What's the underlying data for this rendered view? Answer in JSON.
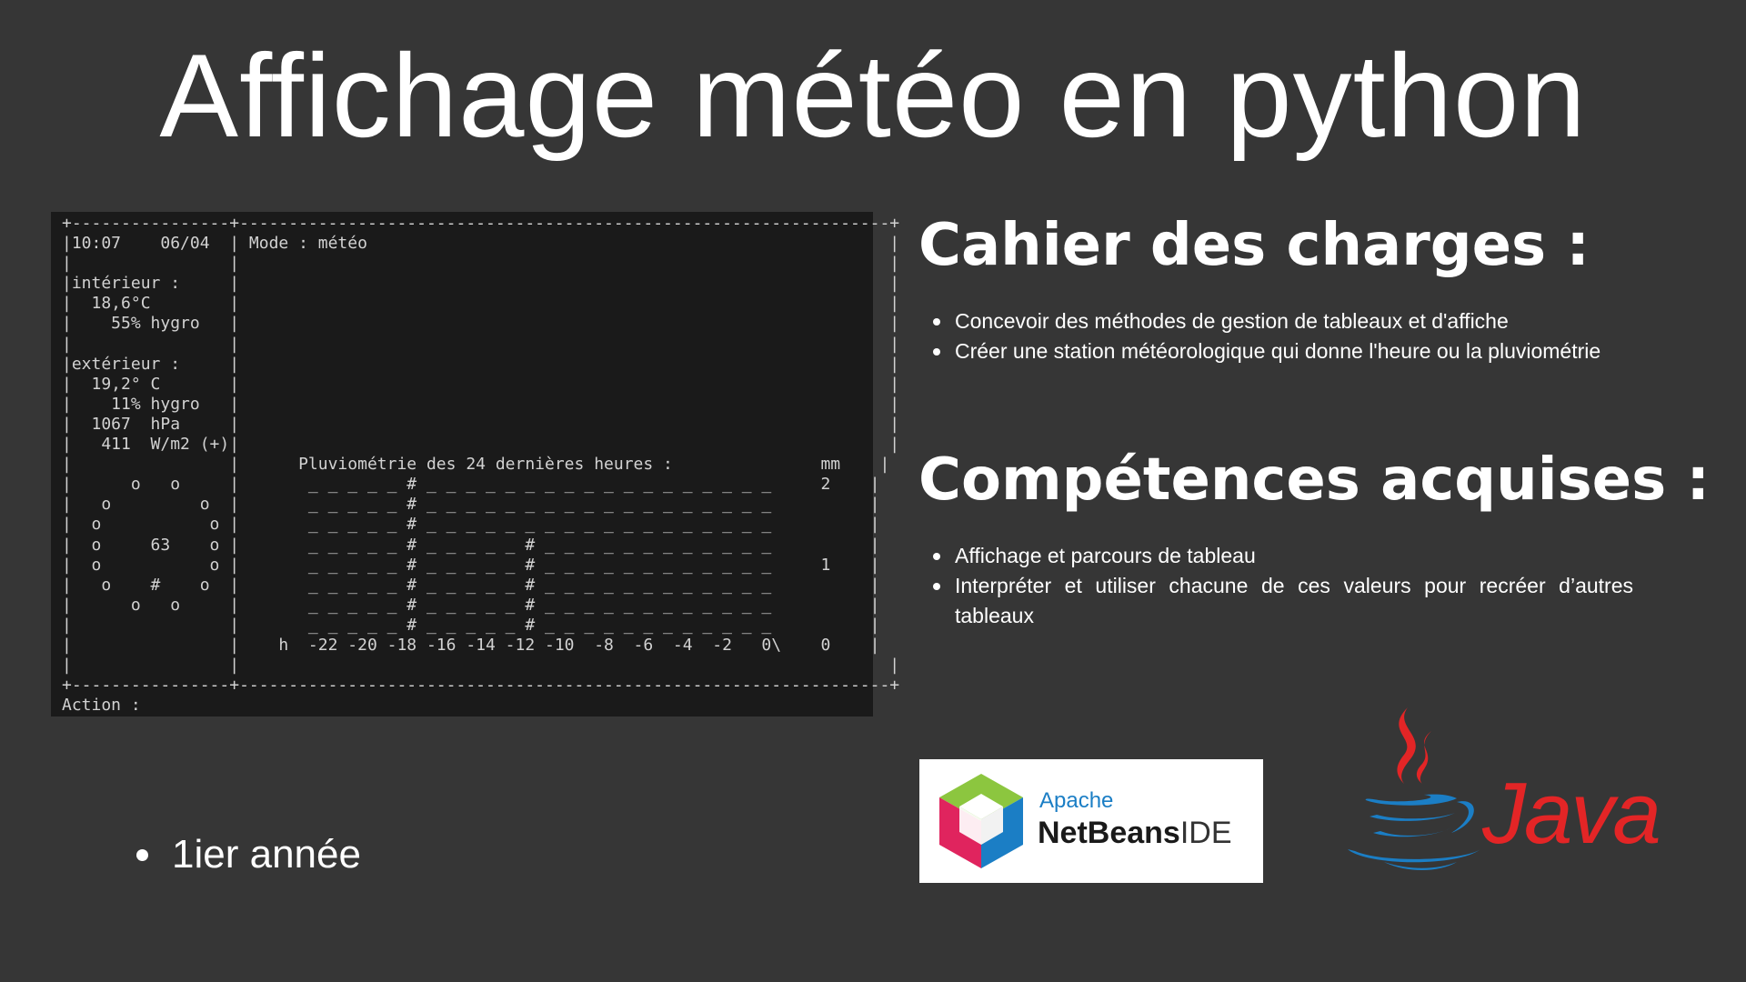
{
  "title": "Affichage météo en python",
  "terminal": {
    "lines": [
      "+----------------+------------------------------------------------------------------+",
      "|10:07    06/04  | Mode : météo                                                     |",
      "|                |                                                                  |",
      "|intérieur :     |                                                                  |",
      "|  18,6°C        |                                                                  |",
      "|    55% hygro   |                                                                  |",
      "|                |                                                                  |",
      "|extérieur :     |                                                                  |",
      "|  19,2° C       |                                                                  |",
      "|    11% hygro   |                                                                  |",
      "|  1067  hPa     |                                                                  |",
      "|   411  W/m2 (+)|                                                                  |",
      "|                |      Pluviométrie des 24 dernières heures :               mm    |",
      "|      o   o     |       _ _ _ _ _ # _ _ _ _ _ _ _ _ _ _ _ _ _ _ _ _ _ _     2    |",
      "|   o         o  |       _ _ _ _ _ # _ _ _ _ _ _ _ _ _ _ _ _ _ _ _ _ _ _          |",
      "|  o           o |       _ _ _ _ _ # _ _ _ _ _ _ _ _ _ _ _ _ _ _ _ _ _ _          |",
      "|  o     63    o |       _ _ _ _ _ # _ _ _ _ _ # _ _ _ _ _ _ _ _ _ _ _ _          |",
      "|  o           o |       _ _ _ _ _ # _ _ _ _ _ # _ _ _ _ _ _ _ _ _ _ _ _     1    |",
      "|   o    #    o  |       _ _ _ _ _ # _ _ _ _ _ # _ _ _ _ _ _ _ _ _ _ _ _          |",
      "|      o   o     |       _ _ _ _ _ # _ _ _ _ _ # _ _ _ _ _ _ _ _ _ _ _ _          |",
      "|                |       _ _ _ _ _ # _ _ _ _ _ # _ _ _ _ _ _ _ _ _ _ _ _          |",
      "|                |    h  -22 -20 -18 -16 -14 -12 -10  -8  -6  -4  -2   0\\    0    |",
      "|                |                                                                  |",
      "+----------------+------------------------------------------------------------------+",
      "Action :"
    ]
  },
  "cahier": {
    "heading": "Cahier des charges :",
    "items": [
      "Concevoir des méthodes de gestion de tableaux et d'affiche",
      "Créer une station météorologique qui donne l'heure ou la pluviométrie"
    ]
  },
  "competences": {
    "heading": "Compétences acquises :",
    "items": [
      "Affichage et parcours de tableau",
      "Interpréter et utiliser chacune de ces valeurs pour recréer d’autres tableaux"
    ]
  },
  "year": "1ier année",
  "netbeans": {
    "apache": "Apache",
    "name": "NetBeans",
    "ide": "IDE"
  },
  "java": {
    "word": "Java"
  }
}
